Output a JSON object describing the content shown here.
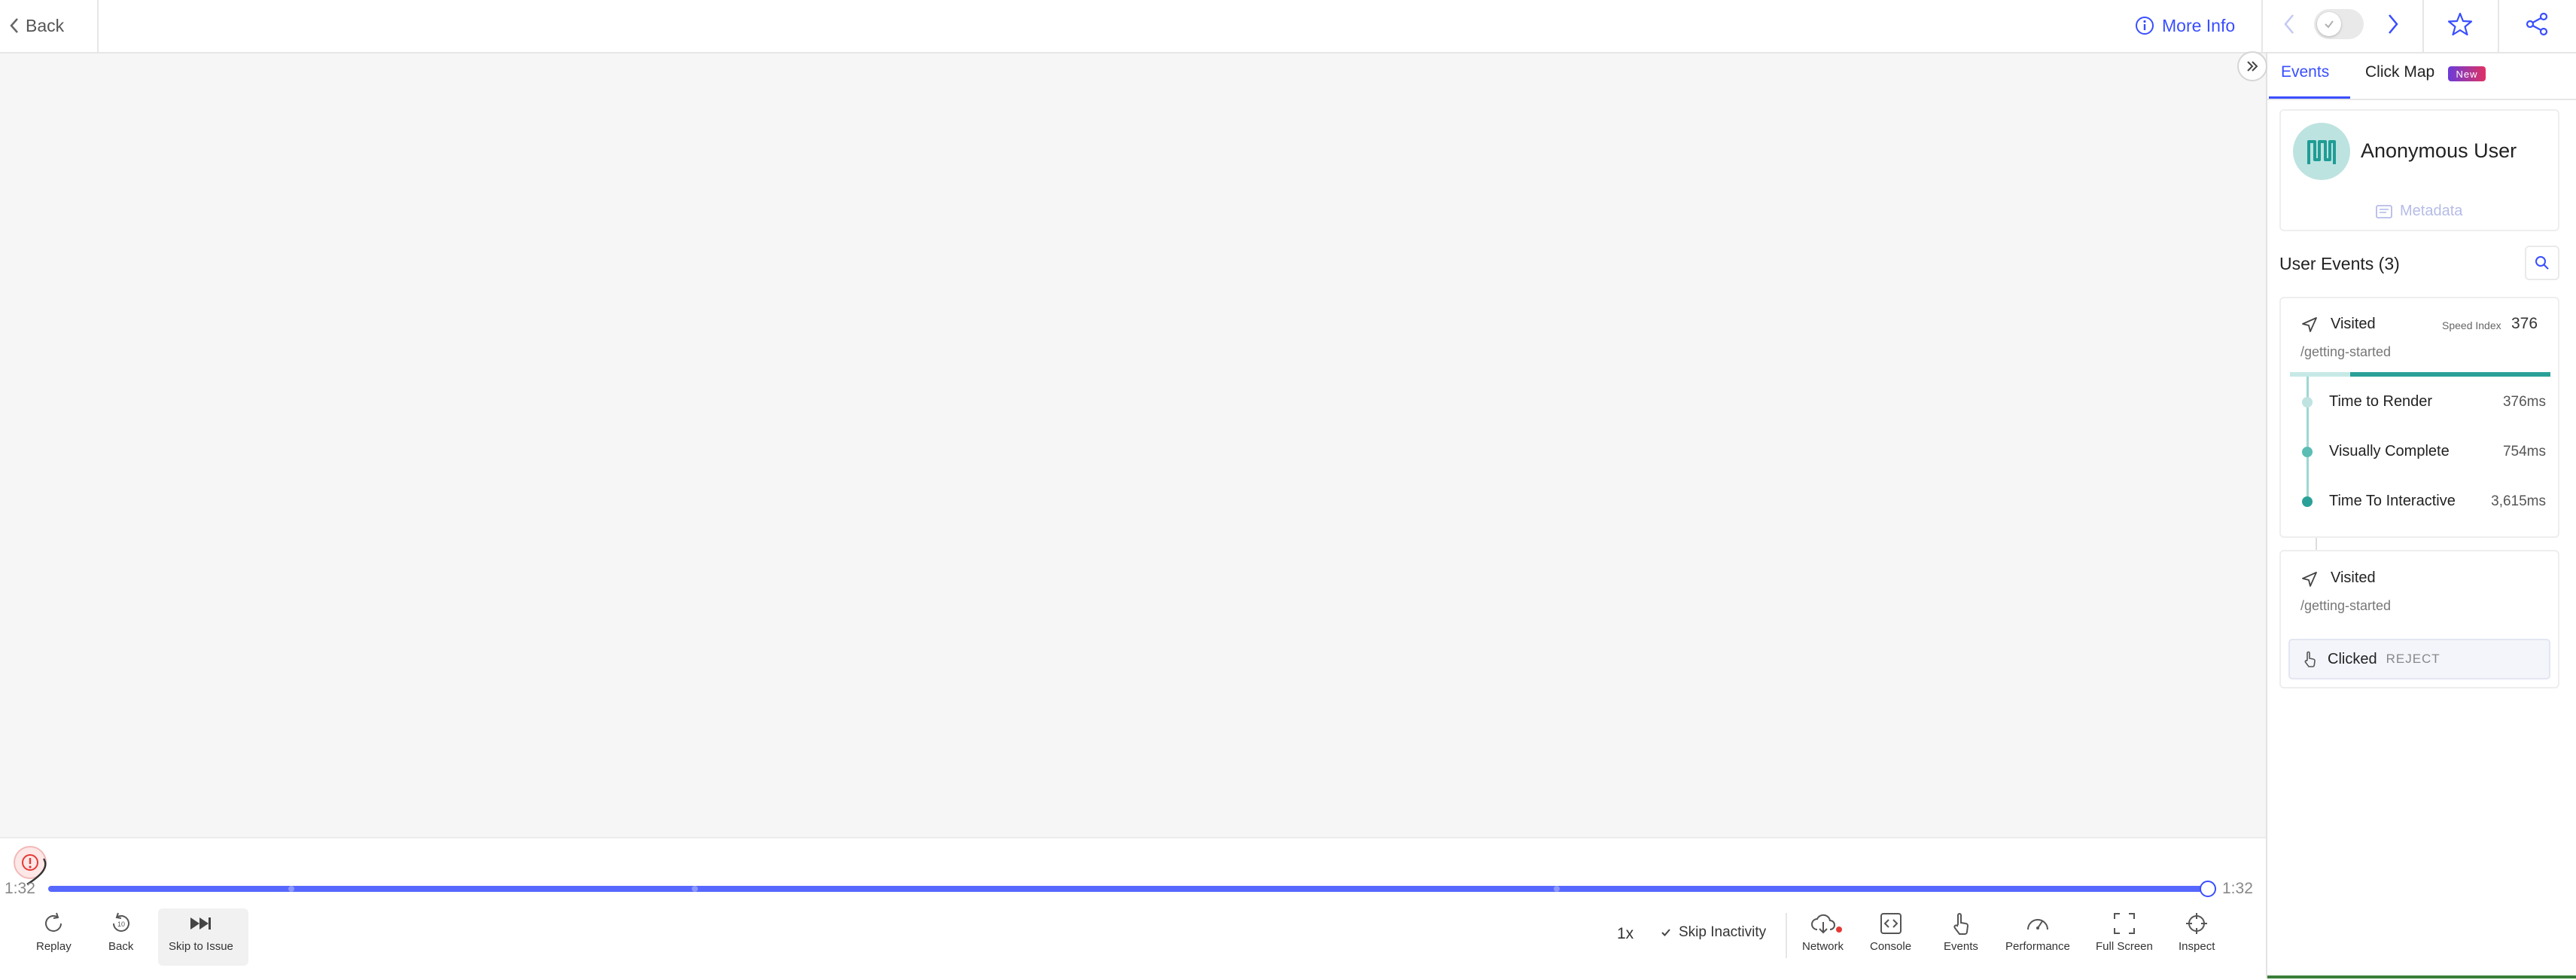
{
  "header": {
    "back_label": "Back",
    "more_info_label": "More Info"
  },
  "player": {
    "time_current": "1:32",
    "time_total": "1:32",
    "speed": "1x",
    "skip_inactivity_label": "Skip Inactivity",
    "controls": {
      "replay": "Replay",
      "back": "Back",
      "skip_to_issue": "Skip to Issue",
      "network": "Network",
      "console": "Console",
      "events": "Events",
      "performance": "Performance",
      "full_screen": "Full Screen",
      "inspect": "Inspect"
    }
  },
  "panel": {
    "tabs": [
      {
        "label": "Events",
        "active": true
      },
      {
        "label": "Click Map",
        "badge": "New"
      }
    ],
    "user": {
      "name": "Anonymous User",
      "metadata_label": "Metadata"
    },
    "events_title": "User Events (3)",
    "events": [
      {
        "type": "Visited",
        "path": "/getting-started",
        "speed_index_label": "Speed Index",
        "speed_index_value": "376",
        "metrics": [
          {
            "label": "Time to Render",
            "value": "376ms"
          },
          {
            "label": "Visually Complete",
            "value": "754ms"
          },
          {
            "label": "Time To Interactive",
            "value": "3,615ms"
          }
        ]
      },
      {
        "type": "Visited",
        "path": "/getting-started"
      },
      {
        "type": "Clicked",
        "target": "REJECT"
      }
    ]
  },
  "colors": {
    "accent": "#394eff",
    "teal": "#2aa198",
    "issue_red": "#e53935"
  }
}
